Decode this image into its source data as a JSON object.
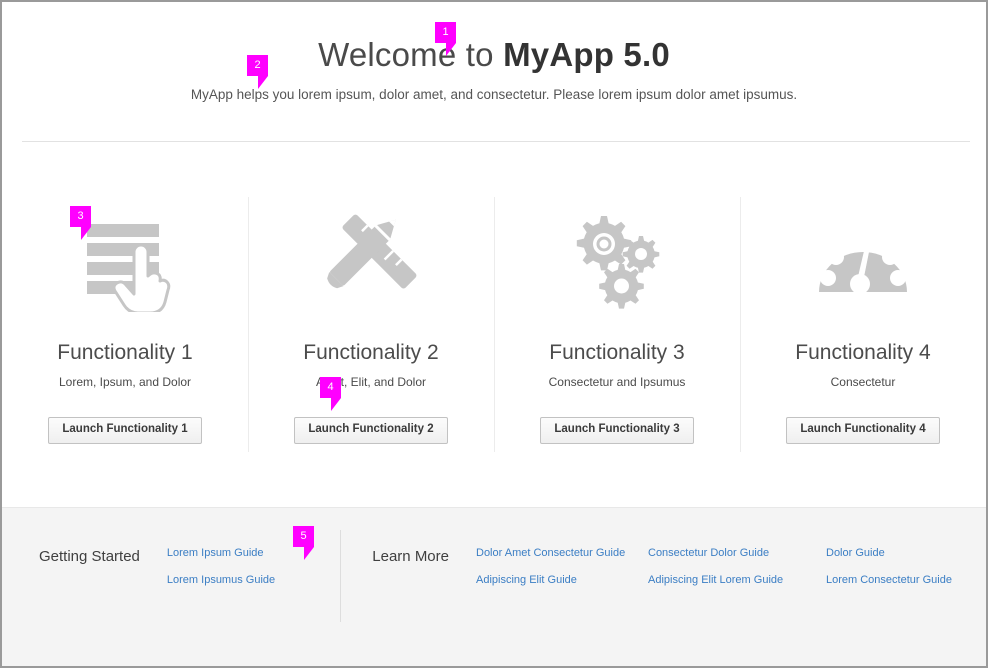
{
  "header": {
    "title_light": "Welcome to ",
    "title_strong": "MyApp 5.0",
    "subtitle": "MyApp helps you lorem ipsum, dolor amet, and consectetur. Please lorem ipsum dolor amet ipsumus."
  },
  "panels": [
    {
      "icon": "list-with-pointing-hand-icon",
      "title": "Functionality 1",
      "subtitle": "Lorem, Ipsum, and Dolor",
      "button": "Launch Functionality 1"
    },
    {
      "icon": "pencil-and-ruler-icon",
      "title": "Functionality 2",
      "subtitle": "Amet, Elit, and Dolor",
      "button": "Launch Functionality 2"
    },
    {
      "icon": "gears-icon",
      "title": "Functionality 3",
      "subtitle": "Consectetur and Ipsumus",
      "button": "Launch Functionality 3"
    },
    {
      "icon": "gauge-icon",
      "title": "Functionality 4",
      "subtitle": "Consectetur",
      "button": "Launch Functionality 4"
    }
  ],
  "footer": {
    "getting_started": {
      "heading": "Getting Started",
      "links": [
        "Lorem Ipsum Guide",
        "Lorem Ipsumus Guide"
      ]
    },
    "learn_more": {
      "heading": "Learn More",
      "groups": [
        [
          "Dolor Amet Consectetur Guide",
          "Adipiscing Elit Guide"
        ],
        [
          "Consectetur Dolor Guide",
          "Adipiscing Elit Lorem Guide"
        ],
        [
          "Dolor Guide",
          "Lorem Consectetur Guide"
        ]
      ]
    }
  },
  "callouts": [
    {
      "number": "1"
    },
    {
      "number": "2"
    },
    {
      "number": "3"
    },
    {
      "number": "4"
    },
    {
      "number": "5"
    }
  ],
  "colors": {
    "callout": "#ff00ff",
    "link": "#3b7ec4",
    "icon": "#c6c6c6",
    "footer_bg": "#f4f4f4"
  }
}
